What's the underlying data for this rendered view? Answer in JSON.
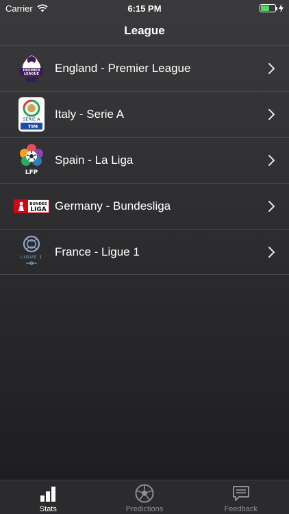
{
  "status_bar": {
    "carrier": "Carrier",
    "time": "6:15 PM",
    "battery_color": "#4cd964",
    "battery_level": 0.6
  },
  "nav": {
    "title": "League"
  },
  "leagues": [
    {
      "label": "England - Premier League",
      "logo_icon": "premier-league-logo"
    },
    {
      "label": "Italy - Serie A",
      "logo_icon": "serie-a-logo",
      "logo_text_1": "SERIE A",
      "logo_text_2": "TIM"
    },
    {
      "label": "Spain - La Liga",
      "logo_icon": "la-liga-logo",
      "logo_text": "LFP"
    },
    {
      "label": "Germany - Bundesliga",
      "logo_icon": "bundesliga-logo",
      "logo_text_1": "BUNDES",
      "logo_text_2": "LIGA"
    },
    {
      "label": "France - Ligue 1",
      "logo_icon": "ligue-1-logo",
      "logo_text": "LIGUE 1"
    }
  ],
  "tabs": [
    {
      "label": "Stats",
      "icon": "bar-chart-icon",
      "active": true
    },
    {
      "label": "Predictions",
      "icon": "soccer-ball-icon",
      "active": false
    },
    {
      "label": "Feedback",
      "icon": "chat-bubble-icon",
      "active": false
    }
  ]
}
